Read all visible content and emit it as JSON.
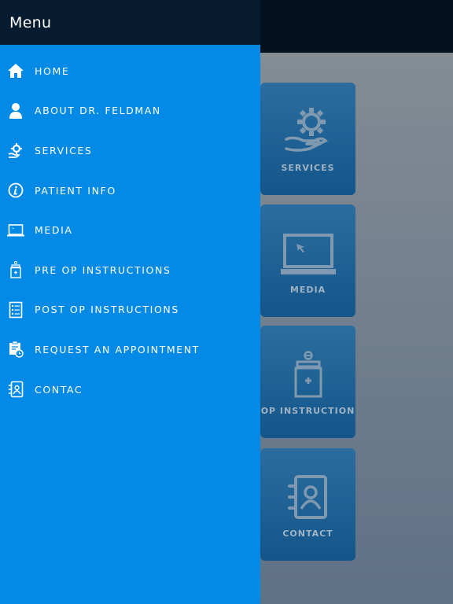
{
  "drawer": {
    "title": "Menu",
    "items": [
      {
        "label": "HOME",
        "icon": "home-icon"
      },
      {
        "label": "ABOUT DR. FELDMAN",
        "icon": "user-icon"
      },
      {
        "label": "SERVICES",
        "icon": "services-gear-hand-icon"
      },
      {
        "label": "PATIENT INFO",
        "icon": "info-icon"
      },
      {
        "label": "MEDIA",
        "icon": "laptop-icon"
      },
      {
        "label": "PRE OP INSTRUCTIONS",
        "icon": "pill-bottle-icon"
      },
      {
        "label": "POST OP INSTRUCTIONS",
        "icon": "checklist-icon"
      },
      {
        "label": "REQUEST AN APPOINTMENT",
        "icon": "clipboard-clock-icon"
      },
      {
        "label": "CONTAC",
        "icon": "contact-book-icon"
      }
    ]
  },
  "background_tiles": [
    {
      "label": "SERVICES",
      "icon": "services-gear-hand-icon"
    },
    {
      "label": "MEDIA",
      "icon": "monitor-cursor-icon"
    },
    {
      "label": "OP INSTRUCTION",
      "icon": "pill-bottle-icon"
    },
    {
      "label": "CONTACT",
      "icon": "contact-book-icon"
    }
  ],
  "colors": {
    "drawer_bg": "#038ae6",
    "drawer_header_bg": "#061b2f",
    "app_topbar_bg": "#04111f",
    "tile_bg": "#14568a"
  }
}
